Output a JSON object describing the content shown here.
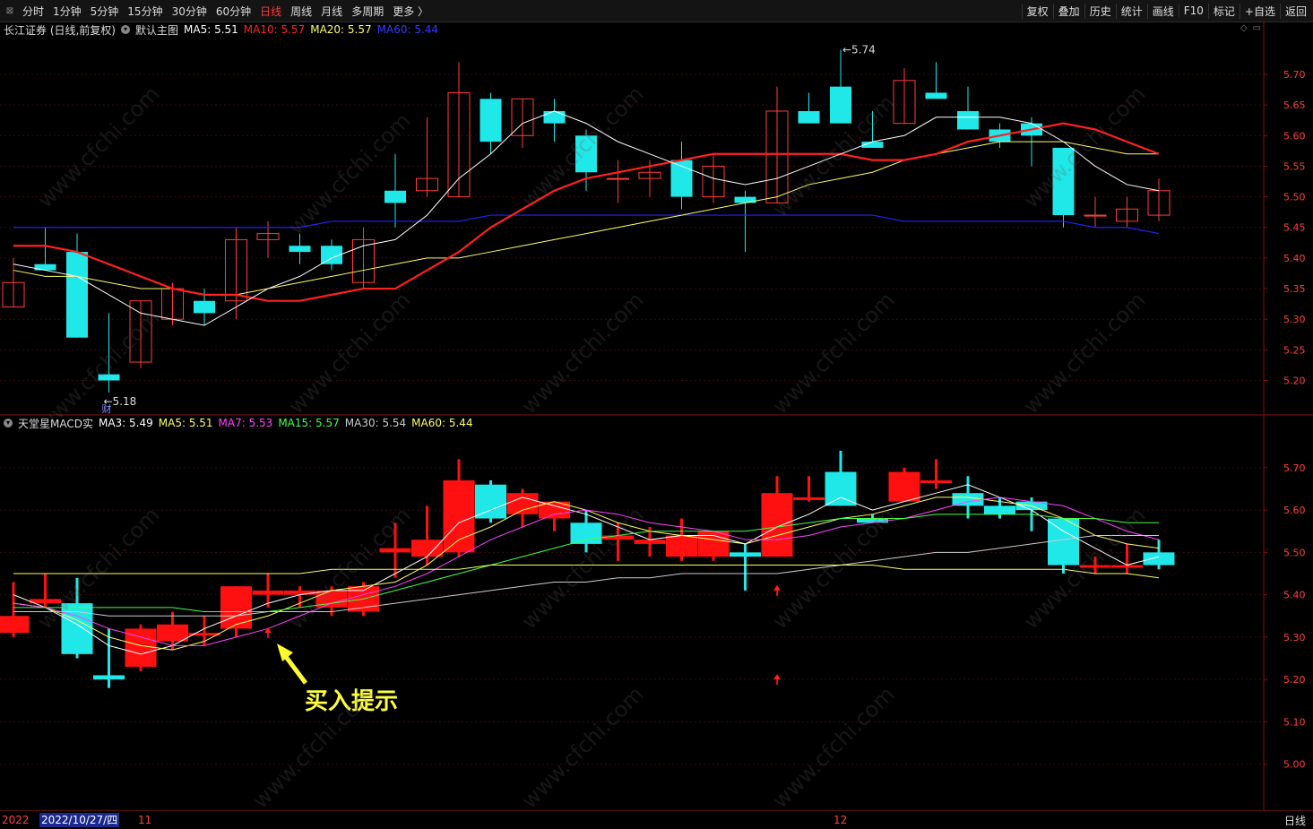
{
  "toolbar": {
    "periods": [
      "分时",
      "1分钟",
      "5分钟",
      "15分钟",
      "30分钟",
      "60分钟",
      "日线",
      "周线",
      "月线",
      "多周期",
      "更多 〉"
    ],
    "active_period": "日线",
    "tools": [
      "复权",
      "叠加",
      "历史",
      "统计",
      "画线",
      "F10",
      "标记",
      "+自选",
      "返回"
    ]
  },
  "main_legend": {
    "stock": "长江证券 (日线,前复权)",
    "template": "默认主图",
    "ma5": "MA5: 5.51",
    "ma10": "MA10: 5.57",
    "ma20": "MA20: 5.57",
    "ma60": "MA60: 5.44",
    "colors": {
      "ma5": "#ffffff",
      "ma10": "#ff2020",
      "ma20": "#ffff66",
      "ma60": "#2222ff"
    }
  },
  "sub_legend": {
    "indicator": "天堂星MACD实",
    "ma3": "MA3: 5.49",
    "ma5": "MA5: 5.51",
    "ma7": "MA7: 5.53",
    "ma15": "MA15: 5.57",
    "ma30": "MA30: 5.54",
    "ma60": "MA60: 5.44",
    "colors": {
      "ma3": "#ffffff",
      "ma5": "#ffff66",
      "ma7": "#ff44ff",
      "ma15": "#44ff44",
      "ma30": "#cccccc",
      "ma60": "#ffff66"
    }
  },
  "annotations": {
    "high_label": "5.74",
    "low_label": "5.18",
    "fin_marker": "财",
    "buy_hint": "买入提示"
  },
  "bottom": {
    "year": "2022",
    "cursor_date": "2022/10/27/四",
    "month_11": "11",
    "month_12": "12",
    "period_label": "日线"
  },
  "watermark": "www.cfchi.com",
  "chart_data": [
    {
      "type": "candlestick",
      "title": "长江证券 (日线,前复权)",
      "y_ticks": [
        5.2,
        5.25,
        5.3,
        5.35,
        5.4,
        5.45,
        5.5,
        5.55,
        5.6,
        5.65,
        5.7
      ],
      "ylim": [
        5.17,
        5.76
      ],
      "candles": [
        {
          "o": 5.32,
          "h": 5.4,
          "l": 5.32,
          "c": 5.36
        },
        {
          "o": 5.39,
          "h": 5.45,
          "l": 5.38,
          "c": 5.38
        },
        {
          "o": 5.41,
          "h": 5.44,
          "l": 5.27,
          "c": 5.27
        },
        {
          "o": 5.21,
          "h": 5.31,
          "l": 5.18,
          "c": 5.2
        },
        {
          "o": 5.23,
          "h": 5.33,
          "l": 5.22,
          "c": 5.33
        },
        {
          "o": 5.3,
          "h": 5.36,
          "l": 5.29,
          "c": 5.35
        },
        {
          "o": 5.33,
          "h": 5.35,
          "l": 5.29,
          "c": 5.31
        },
        {
          "o": 5.33,
          "h": 5.45,
          "l": 5.3,
          "c": 5.43
        },
        {
          "o": 5.43,
          "h": 5.46,
          "l": 5.4,
          "c": 5.44
        },
        {
          "o": 5.42,
          "h": 5.44,
          "l": 5.39,
          "c": 5.41
        },
        {
          "o": 5.42,
          "h": 5.43,
          "l": 5.38,
          "c": 5.39
        },
        {
          "o": 5.36,
          "h": 5.45,
          "l": 5.35,
          "c": 5.43
        },
        {
          "o": 5.51,
          "h": 5.57,
          "l": 5.45,
          "c": 5.49
        },
        {
          "o": 5.51,
          "h": 5.63,
          "l": 5.5,
          "c": 5.53
        },
        {
          "o": 5.5,
          "h": 5.72,
          "l": 5.5,
          "c": 5.67
        },
        {
          "o": 5.66,
          "h": 5.67,
          "l": 5.57,
          "c": 5.59
        },
        {
          "o": 5.6,
          "h": 5.66,
          "l": 5.58,
          "c": 5.66
        },
        {
          "o": 5.64,
          "h": 5.66,
          "l": 5.59,
          "c": 5.62
        },
        {
          "o": 5.6,
          "h": 5.61,
          "l": 5.51,
          "c": 5.54
        },
        {
          "o": 5.53,
          "h": 5.56,
          "l": 5.49,
          "c": 5.53
        },
        {
          "o": 5.53,
          "h": 5.56,
          "l": 5.5,
          "c": 5.54
        },
        {
          "o": 5.56,
          "h": 5.59,
          "l": 5.48,
          "c": 5.5
        },
        {
          "o": 5.5,
          "h": 5.57,
          "l": 5.49,
          "c": 5.55
        },
        {
          "o": 5.5,
          "h": 5.51,
          "l": 5.41,
          "c": 5.49
        },
        {
          "o": 5.49,
          "h": 5.68,
          "l": 5.49,
          "c": 5.64
        },
        {
          "o": 5.64,
          "h": 5.67,
          "l": 5.62,
          "c": 5.62
        },
        {
          "o": 5.68,
          "h": 5.74,
          "l": 5.62,
          "c": 5.62
        },
        {
          "o": 5.59,
          "h": 5.64,
          "l": 5.58,
          "c": 5.58
        },
        {
          "o": 5.62,
          "h": 5.71,
          "l": 5.62,
          "c": 5.69
        },
        {
          "o": 5.67,
          "h": 5.72,
          "l": 5.66,
          "c": 5.66
        },
        {
          "o": 5.64,
          "h": 5.68,
          "l": 5.61,
          "c": 5.61
        },
        {
          "o": 5.61,
          "h": 5.62,
          "l": 5.58,
          "c": 5.59
        },
        {
          "o": 5.62,
          "h": 5.63,
          "l": 5.55,
          "c": 5.6
        },
        {
          "o": 5.58,
          "h": 5.58,
          "l": 5.45,
          "c": 5.47
        },
        {
          "o": 5.47,
          "h": 5.5,
          "l": 5.45,
          "c": 5.47
        },
        {
          "o": 5.46,
          "h": 5.5,
          "l": 5.45,
          "c": 5.48
        },
        {
          "o": 5.47,
          "h": 5.53,
          "l": 5.46,
          "c": 5.51
        }
      ],
      "ma5": [
        5.39,
        5.38,
        5.37,
        5.34,
        5.31,
        5.3,
        5.29,
        5.32,
        5.35,
        5.37,
        5.4,
        5.42,
        5.43,
        5.47,
        5.53,
        5.57,
        5.62,
        5.64,
        5.62,
        5.59,
        5.57,
        5.55,
        5.53,
        5.52,
        5.53,
        5.55,
        5.57,
        5.59,
        5.6,
        5.63,
        5.63,
        5.63,
        5.62,
        5.59,
        5.55,
        5.52,
        5.51
      ],
      "ma10": [
        5.42,
        5.42,
        5.41,
        5.39,
        5.37,
        5.35,
        5.34,
        5.34,
        5.33,
        5.33,
        5.34,
        5.35,
        5.35,
        5.38,
        5.41,
        5.45,
        5.48,
        5.51,
        5.53,
        5.54,
        5.55,
        5.56,
        5.57,
        5.57,
        5.57,
        5.57,
        5.57,
        5.56,
        5.56,
        5.57,
        5.59,
        5.6,
        5.61,
        5.62,
        5.61,
        5.59,
        5.57
      ],
      "ma20": [
        5.38,
        5.37,
        5.37,
        5.36,
        5.35,
        5.35,
        5.34,
        5.34,
        5.35,
        5.36,
        5.37,
        5.38,
        5.39,
        5.4,
        5.4,
        5.41,
        5.42,
        5.43,
        5.44,
        5.45,
        5.46,
        5.47,
        5.48,
        5.49,
        5.5,
        5.52,
        5.53,
        5.54,
        5.56,
        5.57,
        5.58,
        5.59,
        5.59,
        5.59,
        5.58,
        5.57,
        5.57
      ],
      "ma60": [
        5.45,
        5.45,
        5.45,
        5.45,
        5.45,
        5.45,
        5.45,
        5.45,
        5.45,
        5.45,
        5.46,
        5.46,
        5.46,
        5.46,
        5.46,
        5.47,
        5.47,
        5.47,
        5.47,
        5.47,
        5.47,
        5.47,
        5.47,
        5.47,
        5.47,
        5.47,
        5.47,
        5.47,
        5.46,
        5.46,
        5.46,
        5.46,
        5.46,
        5.46,
        5.45,
        5.45,
        5.44
      ]
    },
    {
      "type": "candlestick",
      "title": "天堂星MACD实",
      "y_ticks": [
        5.0,
        5.1,
        5.2,
        5.3,
        5.4,
        5.5,
        5.6,
        5.7
      ],
      "ylim": [
        4.9,
        5.78
      ],
      "candles": [
        {
          "o": 5.31,
          "h": 5.43,
          "l": 5.3,
          "c": 5.35
        },
        {
          "o": 5.38,
          "h": 5.45,
          "l": 5.37,
          "c": 5.39
        },
        {
          "o": 5.38,
          "h": 5.44,
          "l": 5.25,
          "c": 5.26
        },
        {
          "o": 5.21,
          "h": 5.32,
          "l": 5.18,
          "c": 5.2
        },
        {
          "o": 5.23,
          "h": 5.33,
          "l": 5.22,
          "c": 5.32
        },
        {
          "o": 5.29,
          "h": 5.36,
          "l": 5.27,
          "c": 5.33
        },
        {
          "o": 5.31,
          "h": 5.35,
          "l": 5.28,
          "c": 5.31
        },
        {
          "o": 5.32,
          "h": 5.42,
          "l": 5.3,
          "c": 5.42
        },
        {
          "o": 5.4,
          "h": 5.45,
          "l": 5.37,
          "c": 5.41
        },
        {
          "o": 5.4,
          "h": 5.42,
          "l": 5.37,
          "c": 5.41
        },
        {
          "o": 5.37,
          "h": 5.42,
          "l": 5.35,
          "c": 5.41
        },
        {
          "o": 5.36,
          "h": 5.43,
          "l": 5.35,
          "c": 5.42
        },
        {
          "o": 5.5,
          "h": 5.57,
          "l": 5.44,
          "c": 5.51
        },
        {
          "o": 5.49,
          "h": 5.61,
          "l": 5.47,
          "c": 5.53
        },
        {
          "o": 5.5,
          "h": 5.72,
          "l": 5.49,
          "c": 5.67
        },
        {
          "o": 5.66,
          "h": 5.67,
          "l": 5.57,
          "c": 5.58
        },
        {
          "o": 5.59,
          "h": 5.65,
          "l": 5.56,
          "c": 5.64
        },
        {
          "o": 5.58,
          "h": 5.62,
          "l": 5.55,
          "c": 5.62
        },
        {
          "o": 5.57,
          "h": 5.6,
          "l": 5.5,
          "c": 5.52
        },
        {
          "o": 5.53,
          "h": 5.57,
          "l": 5.48,
          "c": 5.54
        },
        {
          "o": 5.52,
          "h": 5.56,
          "l": 5.49,
          "c": 5.53
        },
        {
          "o": 5.49,
          "h": 5.58,
          "l": 5.48,
          "c": 5.54
        },
        {
          "o": 5.49,
          "h": 5.55,
          "l": 5.48,
          "c": 5.55
        },
        {
          "o": 5.5,
          "h": 5.52,
          "l": 5.41,
          "c": 5.49
        },
        {
          "o": 5.49,
          "h": 5.68,
          "l": 5.49,
          "c": 5.64
        },
        {
          "o": 5.63,
          "h": 5.68,
          "l": 5.62,
          "c": 5.63
        },
        {
          "o": 5.69,
          "h": 5.74,
          "l": 5.61,
          "c": 5.61
        },
        {
          "o": 5.58,
          "h": 5.59,
          "l": 5.57,
          "c": 5.57
        },
        {
          "o": 5.62,
          "h": 5.7,
          "l": 5.62,
          "c": 5.69
        },
        {
          "o": 5.67,
          "h": 5.72,
          "l": 5.65,
          "c": 5.67
        },
        {
          "o": 5.64,
          "h": 5.68,
          "l": 5.58,
          "c": 5.61
        },
        {
          "o": 5.61,
          "h": 5.63,
          "l": 5.58,
          "c": 5.59
        },
        {
          "o": 5.62,
          "h": 5.63,
          "l": 5.55,
          "c": 5.6
        },
        {
          "o": 5.58,
          "h": 5.58,
          "l": 5.45,
          "c": 5.47
        },
        {
          "o": 5.47,
          "h": 5.49,
          "l": 5.45,
          "c": 5.47
        },
        {
          "o": 5.47,
          "h": 5.52,
          "l": 5.45,
          "c": 5.47
        },
        {
          "o": 5.5,
          "h": 5.53,
          "l": 5.46,
          "c": 5.47
        }
      ],
      "ma_lines": [
        {
          "name": "MA3",
          "color": "#ffffff",
          "values": [
            5.4,
            5.37,
            5.33,
            5.28,
            5.26,
            5.28,
            5.32,
            5.35,
            5.38,
            5.4,
            5.41,
            5.41,
            5.45,
            5.49,
            5.57,
            5.6,
            5.63,
            5.61,
            5.59,
            5.56,
            5.53,
            5.54,
            5.54,
            5.52,
            5.56,
            5.59,
            5.63,
            5.6,
            5.62,
            5.64,
            5.66,
            5.63,
            5.6,
            5.55,
            5.51,
            5.47,
            5.49
          ]
        },
        {
          "name": "MA5",
          "color": "#ffff66",
          "values": [
            5.38,
            5.37,
            5.34,
            5.3,
            5.28,
            5.27,
            5.29,
            5.33,
            5.35,
            5.38,
            5.41,
            5.42,
            5.43,
            5.47,
            5.53,
            5.56,
            5.6,
            5.62,
            5.6,
            5.57,
            5.55,
            5.54,
            5.53,
            5.52,
            5.54,
            5.56,
            5.58,
            5.59,
            5.61,
            5.63,
            5.63,
            5.62,
            5.61,
            5.58,
            5.54,
            5.52,
            5.51
          ]
        },
        {
          "name": "MA7",
          "color": "#ff44ff",
          "values": [
            5.38,
            5.37,
            5.35,
            5.32,
            5.3,
            5.28,
            5.28,
            5.3,
            5.32,
            5.35,
            5.38,
            5.4,
            5.42,
            5.45,
            5.49,
            5.53,
            5.56,
            5.59,
            5.6,
            5.59,
            5.57,
            5.56,
            5.55,
            5.53,
            5.53,
            5.54,
            5.56,
            5.57,
            5.58,
            5.6,
            5.62,
            5.63,
            5.62,
            5.61,
            5.58,
            5.55,
            5.53
          ]
        },
        {
          "name": "MA15",
          "color": "#44ff44",
          "values": [
            5.37,
            5.37,
            5.37,
            5.37,
            5.37,
            5.37,
            5.36,
            5.36,
            5.36,
            5.37,
            5.38,
            5.39,
            5.41,
            5.43,
            5.45,
            5.47,
            5.49,
            5.51,
            5.53,
            5.54,
            5.55,
            5.55,
            5.55,
            5.55,
            5.56,
            5.57,
            5.58,
            5.58,
            5.58,
            5.59,
            5.59,
            5.59,
            5.59,
            5.58,
            5.58,
            5.57,
            5.57
          ]
        },
        {
          "name": "MA30",
          "color": "#cccccc",
          "values": [
            5.36,
            5.36,
            5.36,
            5.35,
            5.35,
            5.35,
            5.35,
            5.35,
            5.36,
            5.36,
            5.36,
            5.37,
            5.38,
            5.39,
            5.4,
            5.41,
            5.42,
            5.43,
            5.43,
            5.44,
            5.44,
            5.45,
            5.45,
            5.45,
            5.45,
            5.46,
            5.47,
            5.48,
            5.49,
            5.5,
            5.5,
            5.51,
            5.52,
            5.53,
            5.54,
            5.54,
            5.54
          ]
        },
        {
          "name": "MA60",
          "color": "#ffff66",
          "values": [
            5.45,
            5.45,
            5.45,
            5.45,
            5.45,
            5.45,
            5.45,
            5.45,
            5.45,
            5.45,
            5.46,
            5.46,
            5.46,
            5.46,
            5.46,
            5.47,
            5.47,
            5.47,
            5.47,
            5.47,
            5.47,
            5.47,
            5.47,
            5.47,
            5.47,
            5.47,
            5.47,
            5.47,
            5.46,
            5.46,
            5.46,
            5.46,
            5.46,
            5.46,
            5.45,
            5.45,
            5.44
          ]
        }
      ],
      "buy_signals": [
        {
          "index": 8,
          "value": 5.31
        },
        {
          "index": 24,
          "value": 5.41
        },
        {
          "index": 24,
          "value": 5.2
        }
      ]
    }
  ]
}
